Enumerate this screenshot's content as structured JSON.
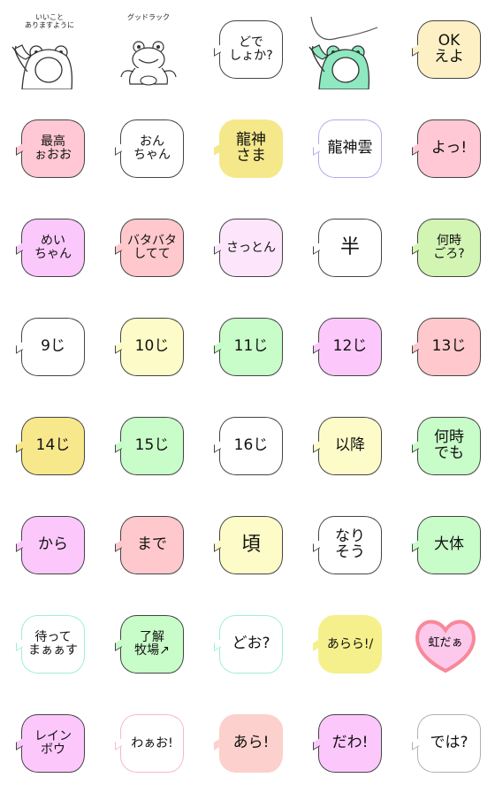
{
  "sticker_set": {
    "rows": 8,
    "columns": 5,
    "stickers": [
      {
        "type": "frog",
        "caption": [
          "いいこと",
          "ありますように"
        ],
        "color": "#ffffff",
        "border": "#444444"
      },
      {
        "type": "frog",
        "caption": [
          "グッドラック"
        ],
        "color": "#ffffff",
        "border": "#444444"
      },
      {
        "type": "bubble",
        "lines": [
          "どで",
          "しょか?"
        ],
        "color": "#ffffff",
        "border": "#444444"
      },
      {
        "type": "frog-green",
        "caption": [],
        "color": "#8ee8c0",
        "border": "#444444"
      },
      {
        "type": "bubble",
        "lines": [
          "OK",
          "えよ"
        ],
        "color": "#fdf0c4",
        "border": "#444444"
      },
      {
        "type": "bubble",
        "lines": [
          "最高",
          "ぉおお"
        ],
        "color": "#ffc8d4",
        "border": "#444444"
      },
      {
        "type": "bubble",
        "lines": [
          "おん",
          "ちゃん"
        ],
        "color": "#ffffff",
        "border": "#444444"
      },
      {
        "type": "bubble",
        "lines": [
          "龍神",
          "さま"
        ],
        "color": "#f5e88a",
        "border": "none"
      },
      {
        "type": "bubble",
        "lines": [
          "龍神雲"
        ],
        "color": "#ffffff",
        "border": "#b8a8f0"
      },
      {
        "type": "bubble",
        "lines": [
          "よっ!"
        ],
        "color": "#ffc8d4",
        "border": "#444444"
      },
      {
        "type": "bubble",
        "lines": [
          "めい",
          "ちゃん"
        ],
        "color": "#fbc8fb",
        "border": "#444444"
      },
      {
        "type": "bubble",
        "lines": [
          "バタバタ",
          "してて"
        ],
        "color": "#ffc8cc",
        "border": "#444444"
      },
      {
        "type": "bubble",
        "lines": [
          "さっとん"
        ],
        "color": "#fde6fb",
        "border": "#444444"
      },
      {
        "type": "bubble",
        "lines": [
          "半"
        ],
        "color": "#ffffff",
        "border": "#444444"
      },
      {
        "type": "bubble",
        "lines": [
          "何時",
          "ごろ?"
        ],
        "color": "#d2f5b4",
        "border": "#444444"
      },
      {
        "type": "bubble",
        "lines": [
          "9じ"
        ],
        "color": "#ffffff",
        "border": "#444444"
      },
      {
        "type": "bubble",
        "lines": [
          "10じ"
        ],
        "color": "#fdfcc8",
        "border": "#444444"
      },
      {
        "type": "bubble",
        "lines": [
          "11じ"
        ],
        "color": "#c8fcc8",
        "border": "#444444"
      },
      {
        "type": "bubble",
        "lines": [
          "12じ"
        ],
        "color": "#fcc8fc",
        "border": "#444444"
      },
      {
        "type": "bubble",
        "lines": [
          "13じ"
        ],
        "color": "#ffc8cc",
        "border": "#444444"
      },
      {
        "type": "bubble",
        "lines": [
          "14じ"
        ],
        "color": "#f8e88c",
        "border": "#444444"
      },
      {
        "type": "bubble",
        "lines": [
          "15じ"
        ],
        "color": "#c8fcc8",
        "border": "#444444"
      },
      {
        "type": "bubble",
        "lines": [
          "16じ"
        ],
        "color": "#ffffff",
        "border": "#444444"
      },
      {
        "type": "bubble",
        "lines": [
          "以降"
        ],
        "color": "#fdfcc8",
        "border": "#444444"
      },
      {
        "type": "bubble",
        "lines": [
          "何時",
          "でも"
        ],
        "color": "#c8fcc8",
        "border": "#444444"
      },
      {
        "type": "bubble",
        "lines": [
          "から"
        ],
        "color": "#fcc8fc",
        "border": "#444444"
      },
      {
        "type": "bubble",
        "lines": [
          "まで"
        ],
        "color": "#ffc8cc",
        "border": "#444444"
      },
      {
        "type": "bubble",
        "lines": [
          "頃"
        ],
        "color": "#fdfcc8",
        "border": "#444444"
      },
      {
        "type": "bubble",
        "lines": [
          "なり",
          "そう"
        ],
        "color": "#ffffff",
        "border": "#444444"
      },
      {
        "type": "bubble",
        "lines": [
          "大体"
        ],
        "color": "#c8fcc8",
        "border": "#444444"
      },
      {
        "type": "bubble",
        "lines": [
          "待って",
          "まぁぁす"
        ],
        "color": "#ffffff",
        "border": "#9ef0d0"
      },
      {
        "type": "bubble",
        "lines": [
          "了解",
          "牧場↗"
        ],
        "color": "#c8fcc8",
        "border": "#444444"
      },
      {
        "type": "bubble",
        "lines": [
          "どお?"
        ],
        "color": "#ffffff",
        "border": "#9ef0d0"
      },
      {
        "type": "bubble",
        "lines": [
          "あらら!/"
        ],
        "color": "#f5f08c",
        "border": "none"
      },
      {
        "type": "heart",
        "lines": [
          "虹だぁ"
        ],
        "color": "#fcc8ec",
        "border": "#f88898"
      },
      {
        "type": "bubble",
        "lines": [
          "レイン",
          "ボウ"
        ],
        "color": "#fcc8fc",
        "border": "#444444"
      },
      {
        "type": "bubble",
        "lines": [
          "わぁお!"
        ],
        "color": "#ffffff",
        "border": "#f8b8c8"
      },
      {
        "type": "bubble",
        "lines": [
          "あら!"
        ],
        "color": "#fcd0cc",
        "border": "none"
      },
      {
        "type": "bubble",
        "lines": [
          "だわ!"
        ],
        "color": "#fcc8fc",
        "border": "#444444"
      },
      {
        "type": "bubble",
        "lines": [
          "では?"
        ],
        "color": "#ffffff",
        "border": "#b0b0b8"
      }
    ]
  }
}
